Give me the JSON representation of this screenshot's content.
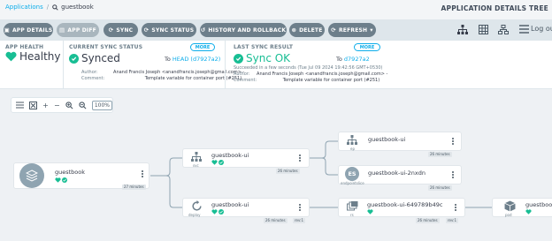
{
  "breadcrumb": {
    "root": "Applications",
    "app": "guestbook"
  },
  "page_title": "APPLICATION DETAILS TREE",
  "toolbar": {
    "app_details": "APP DETAILS",
    "app_diff": "APP DIFF",
    "sync": "SYNC",
    "sync_status": "SYNC STATUS",
    "history": "HISTORY AND ROLLBACK",
    "delete": "DELETE",
    "refresh": "REFRESH",
    "logout": "Log out"
  },
  "status": {
    "health_header": "APP HEALTH",
    "health_value": "Healthy",
    "sync_header": "CURRENT SYNC STATUS",
    "sync_value": "Synced",
    "sync_to": "To",
    "sync_to_rev": "HEAD (d7927a2)",
    "sync_more": "MORE",
    "sync_author_label": "Author:",
    "sync_author": "Anand Francis Joseph <anandfrancis.joseph@gmail.com> -",
    "sync_comment_label": "Comment:",
    "sync_comment": "Template variable for container port (#251)",
    "last_header": "LAST SYNC RESULT",
    "last_value": "Sync OK",
    "last_to": "To",
    "last_to_rev": "d7927a2",
    "last_more": "MORE",
    "last_time": "Succeeded in a few seconds (Tue Jul 09 2024 19:42:56 GMT+0530)",
    "last_author_label": "Author:",
    "last_author": "Anand Francis Joseph <anandfrancis.joseph@gmail.com> -",
    "last_comment_label": "Comment:",
    "last_comment": "Template variable for container port (#251)"
  },
  "zoom": {
    "level": "100%"
  },
  "nodes": {
    "app": {
      "name": "guestbook",
      "age": "27 minutes"
    },
    "svc": {
      "name": "guestbook-ui",
      "kind": "svc",
      "age": "26 minutes"
    },
    "deploy": {
      "name": "guestbook-ui",
      "kind": "deploy",
      "age": "26 minutes",
      "rev": "rev:1"
    },
    "ep": {
      "name": "guestbook-ui",
      "kind": "ep",
      "age": "26 minutes"
    },
    "endpointslice": {
      "name": "guestbook-ui-2nxdn",
      "kind": "endpointslice",
      "icon_text": "ES",
      "age": "26 minutes"
    },
    "rs": {
      "name": "guestbook-ui-649789b49c",
      "kind": "rs",
      "age": "26 minutes",
      "rev": "rev:1"
    },
    "pod": {
      "name": "guestbook-",
      "kind": "pod"
    }
  },
  "colors": {
    "healthy": "#18be94",
    "accent": "#0dadea",
    "button": "#6d7f8b"
  }
}
